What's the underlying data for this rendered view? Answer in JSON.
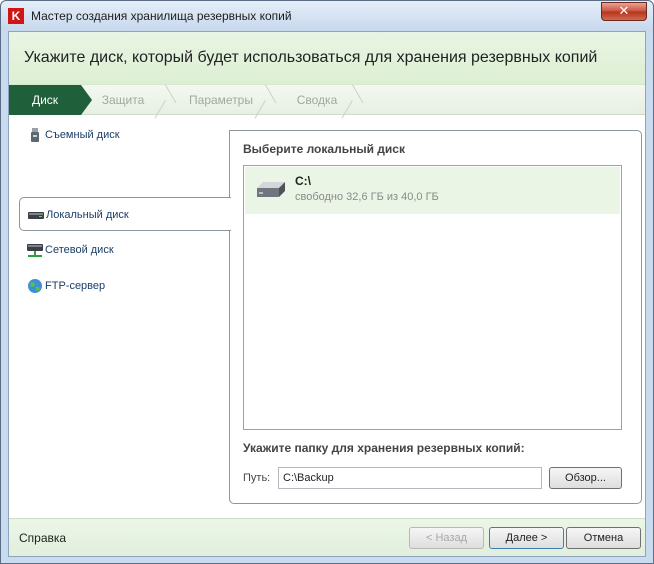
{
  "window": {
    "title": "Мастер создания хранилища резервных копий",
    "app_icon_glyph": "K",
    "close_glyph": "✕"
  },
  "header": {
    "title": "Укажите диск, который будет использоваться для хранения резервных копий"
  },
  "steps": [
    {
      "label": "Диск",
      "active": true
    },
    {
      "label": "Защита",
      "active": false
    },
    {
      "label": "Параметры",
      "active": false
    },
    {
      "label": "Сводка",
      "active": false
    }
  ],
  "sidebar": {
    "items": [
      {
        "label": "Съемный диск",
        "icon": "usb-drive-icon"
      },
      {
        "label": "Локальный диск",
        "icon": "hard-drive-icon",
        "selected": true
      },
      {
        "label": "Сетевой диск",
        "icon": "network-drive-icon"
      },
      {
        "label": "FTP-сервер",
        "icon": "globe-icon"
      }
    ]
  },
  "panel": {
    "title": "Выберите локальный диск",
    "disks": [
      {
        "name": "C:\\",
        "free": "свободно 32,6 ГБ из 40,0 ГБ"
      }
    ],
    "folder_label": "Укажите папку для хранения резервных копий:",
    "path_label": "Путь:",
    "path_value": "C:\\Backup",
    "browse_label": "Обзор..."
  },
  "footer": {
    "help_label": "Справка",
    "back_label": "< Назад",
    "next_label": "Далее >",
    "cancel_label": "Отмена"
  },
  "colors": {
    "active_step": "#1f5f3a",
    "header_bg": "#e9f5e4",
    "selected_disk_bg": "#eaf5e5",
    "link_text": "#1a3e6b"
  }
}
